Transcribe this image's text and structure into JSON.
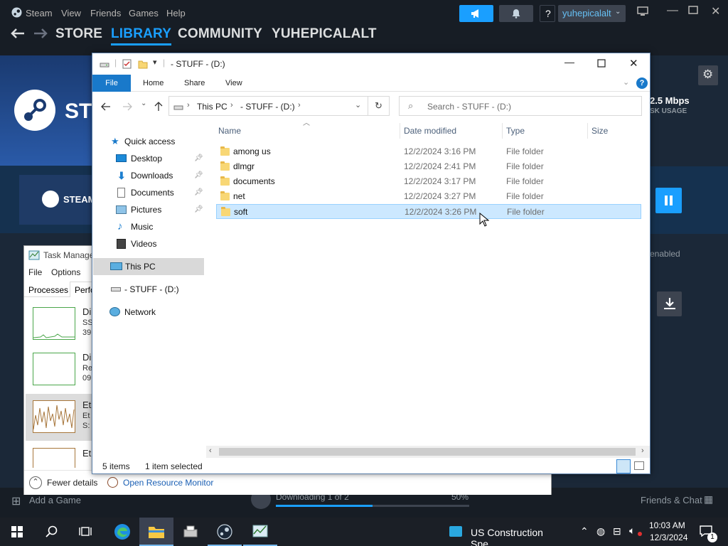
{
  "steam": {
    "menu": [
      "Steam",
      "View",
      "Friends",
      "Games",
      "Help"
    ],
    "nav": [
      "STORE",
      "LIBRARY",
      "COMMUNITY",
      "YUHEPICALALT"
    ],
    "username": "yuhepicalalt",
    "help_label": "?",
    "banner_text": "ST",
    "steam_logo_text": "STEAM",
    "speed": "2.5 Mbps",
    "disk_usage": "SK USAGE",
    "enabled_text": "enabled",
    "bottom": {
      "add_game": "Add a Game",
      "downloading": "Downloading 1 of 2",
      "percent": "50%",
      "progress": 0.5,
      "friends_chat": "Friends & Chat"
    },
    "accent": "#1a9fff"
  },
  "taskmgr": {
    "title": "Task Manage",
    "menu": [
      "File",
      "Options"
    ],
    "tabs": [
      "Processes",
      "Perfo"
    ],
    "items": [
      {
        "label": "Di",
        "sub1": "SS",
        "sub2": "39"
      },
      {
        "label": "Di",
        "sub1": "Re",
        "sub2": "09"
      },
      {
        "label": "Et",
        "sub1": "Et",
        "sub2": "S:"
      },
      {
        "label": "Et",
        "sub1": "",
        "sub2": ""
      }
    ],
    "fewer_details": "Fewer details",
    "open_resource_monitor": "Open Resource Monitor"
  },
  "explorer": {
    "title": "- STUFF - (D:)",
    "ribbon_tabs": [
      "File",
      "Home",
      "Share",
      "View"
    ],
    "breadcrumb": [
      "This PC",
      "- STUFF - (D:)"
    ],
    "search_placeholder": "Search - STUFF - (D:)",
    "nav": {
      "quick_access": "Quick access",
      "desktop": "Desktop",
      "downloads": "Downloads",
      "documents": "Documents",
      "pictures": "Pictures",
      "music": "Music",
      "videos": "Videos",
      "this_pc": "This PC",
      "drive": "- STUFF - (D:)",
      "network": "Network"
    },
    "columns": [
      "Name",
      "Date modified",
      "Type",
      "Size"
    ],
    "files": [
      {
        "name": "among us",
        "date": "12/2/2024 3:16 PM",
        "type": "File folder"
      },
      {
        "name": "dlmgr",
        "date": "12/2/2024 2:41 PM",
        "type": "File folder"
      },
      {
        "name": "documents",
        "date": "12/2/2024 3:17 PM",
        "type": "File folder"
      },
      {
        "name": "net",
        "date": "12/2/2024 3:27 PM",
        "type": "File folder"
      },
      {
        "name": "soft",
        "date": "12/2/2024 3:26 PM",
        "type": "File folder"
      }
    ],
    "status_count": "5 items",
    "status_selected": "1 item selected"
  },
  "taskbar": {
    "active_app": "US Construction Spe...",
    "time": "10:03 AM",
    "date": "12/3/2024",
    "notif_count": "1"
  }
}
